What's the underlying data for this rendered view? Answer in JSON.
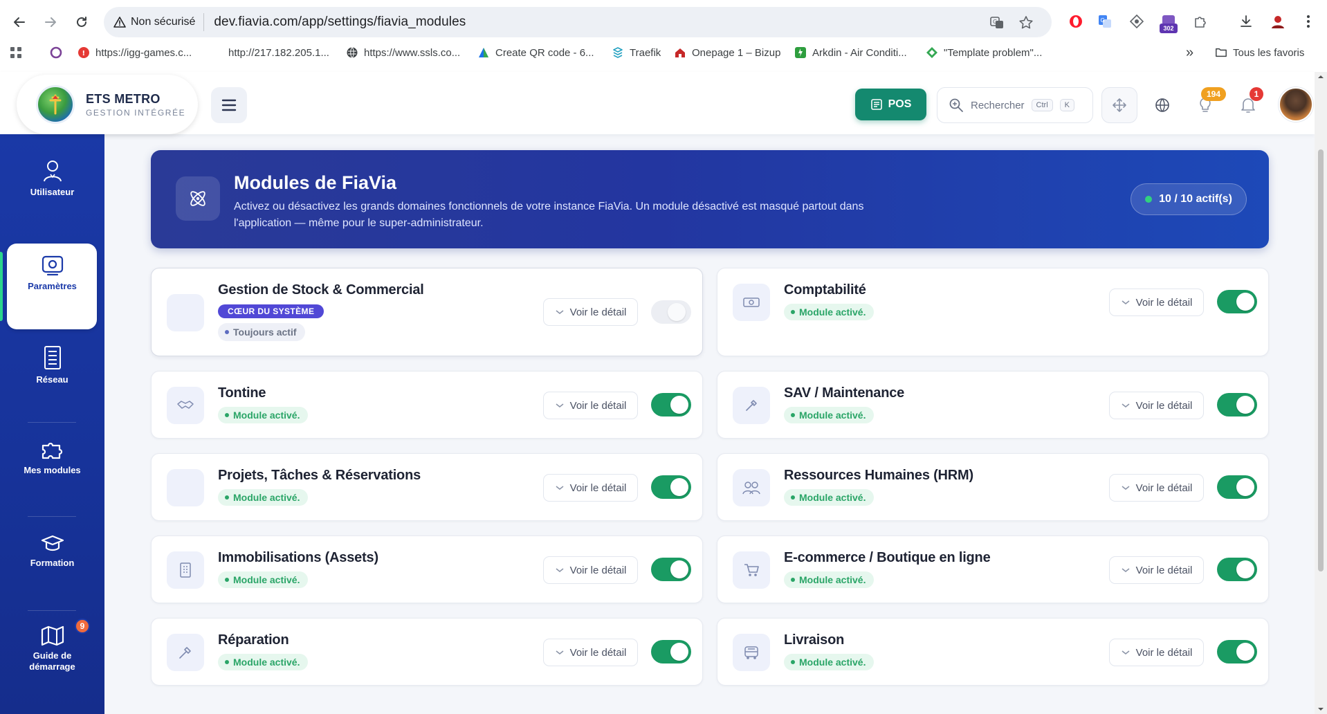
{
  "browser": {
    "security_label": "Non sécurisé",
    "url": "dev.fiavia.com/app/settings/fiavia_modules",
    "ext_badge_count": "302",
    "bookmarks": [
      {
        "label": "https://igg-games.c..."
      },
      {
        "label": "http://217.182.205.1..."
      },
      {
        "label": "https://www.ssls.co..."
      },
      {
        "label": "Create QR code - 6..."
      },
      {
        "label": "Traefik"
      },
      {
        "label": "Onepage 1 – Bizup"
      },
      {
        "label": "Arkdin - Air Conditi..."
      },
      {
        "label": "\"Template problem\"..."
      }
    ],
    "more_label": "»",
    "favorites_label": "Tous les favoris"
  },
  "app": {
    "brand_name": "ETS METRO",
    "brand_tagline": "GESTION INTÉGRÉE",
    "pos_label": "POS",
    "search_placeholder": "Rechercher",
    "search_key1": "Ctrl",
    "search_key2": "K",
    "idea_badge": "194",
    "notif_badge": "1"
  },
  "sidebar": {
    "items": [
      {
        "label": "Utilisateur",
        "icon": "user-icon"
      },
      {
        "label": "Paramètres",
        "icon": "settings-icon",
        "active": true
      },
      {
        "label": "Réseau",
        "icon": "network-icon"
      },
      {
        "label": "Mes modules",
        "icon": "puzzle-icon"
      },
      {
        "label": "Formation",
        "icon": "graduation-cap-icon"
      },
      {
        "label": "Guide de démarrage",
        "icon": "map-icon",
        "badge": "9"
      }
    ]
  },
  "hero": {
    "title": "Modules de FiaVia",
    "description": "Activez ou désactivez les grands domaines fonctionnels de votre instance FiaVia. Un module désactivé est masqué partout dans l'application — même pour le super-administrateur.",
    "active_count": "10 / 10 actif(s)"
  },
  "modules": [
    {
      "title": "Gestion de Stock & Commercial",
      "core_badge": "CŒUR DU SYSTÈME",
      "always_badge": "Toujours actif",
      "detail": "Voir le détail",
      "enabled": true
    },
    {
      "title": "Comptabilité",
      "status": "Module activé.",
      "detail": "Voir le détail",
      "enabled": true
    },
    {
      "title": "Tontine",
      "status": "Module activé.",
      "detail": "Voir le détail",
      "enabled": true
    },
    {
      "title": "SAV / Maintenance",
      "status": "Module activé.",
      "detail": "Voir le détail",
      "enabled": true
    },
    {
      "title": "Projets, Tâches & Réservations",
      "status": "Module activé.",
      "detail": "Voir le détail",
      "enabled": true
    },
    {
      "title": "Ressources Humaines (HRM)",
      "status": "Module activé.",
      "detail": "Voir le détail",
      "enabled": true
    },
    {
      "title": "Immobilisations (Assets)",
      "status": "Module activé.",
      "detail": "Voir le détail",
      "enabled": true
    },
    {
      "title": "E-commerce / Boutique en ligne",
      "status": "Module activé.",
      "detail": "Voir le détail",
      "enabled": true
    },
    {
      "title": "Réparation",
      "status": "Module activé.",
      "detail": "Voir le détail",
      "enabled": true
    },
    {
      "title": "Livraison",
      "status": "Module activé.",
      "detail": "Voir le détail",
      "enabled": true
    }
  ],
  "colors": {
    "sidebar": "#1b3aa9",
    "hero": "#2336a0",
    "pos": "#14896f",
    "toggle_on": "#1a9b63",
    "status_green": "#2aa567",
    "core_badge": "#5148d6"
  }
}
